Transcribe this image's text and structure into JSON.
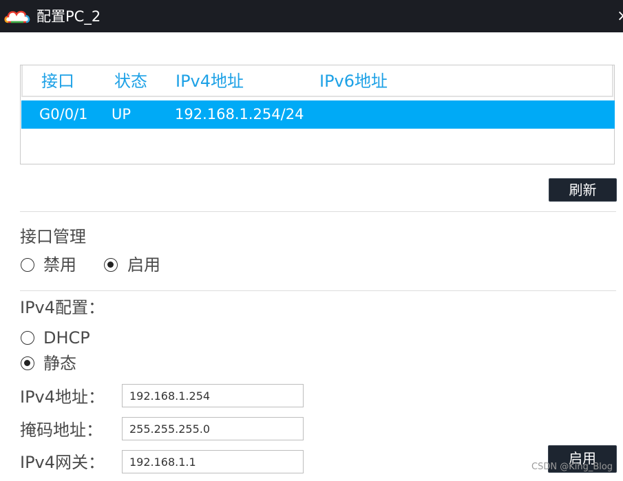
{
  "window": {
    "title": "配置PC_2",
    "close_symbol": "×",
    "icon": "cloud-logo-icon"
  },
  "interface_table": {
    "columns": [
      "接口",
      "状态",
      "IPv4地址",
      "IPv6地址"
    ],
    "rows": [
      {
        "interface": "G0/0/1",
        "status": "UP",
        "ipv4": "192.168.1.254/24",
        "ipv6": ""
      }
    ],
    "selected_row_color": "#00aaf6",
    "header_color": "#1da1e6"
  },
  "buttons": {
    "refresh": "刷新",
    "apply": "启用"
  },
  "interface_management": {
    "label": "接口管理",
    "options": [
      {
        "label": "禁用",
        "checked": false
      },
      {
        "label": "启用",
        "checked": true
      }
    ]
  },
  "ipv4_config": {
    "label": "IPv4配置：",
    "options": [
      {
        "label": "DHCP",
        "checked": false
      },
      {
        "label": "静态",
        "checked": true
      }
    ],
    "fields": {
      "address_label": "IPv4地址：",
      "address_value": "192.168.1.254",
      "mask_label": "掩码地址：",
      "mask_value": "255.255.255.0",
      "gateway_label": "IPv4网关：",
      "gateway_value": "192.168.1.1"
    }
  },
  "watermark": "CSDN @King_Blog"
}
